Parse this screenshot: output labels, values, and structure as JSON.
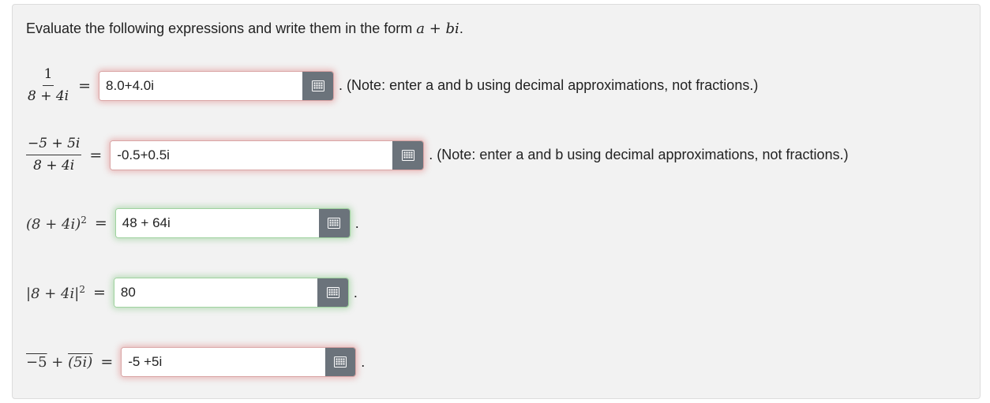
{
  "intro": {
    "text": "Evaluate the following expressions and write them in the form",
    "form": "a + bi",
    "period": "."
  },
  "problems": [
    {
      "label_num": "1",
      "label_den": "8 + 4i",
      "equals": "=",
      "answer": "8.0+4.0i",
      "status": "incorrect",
      "note": ". (Note: enter a and b using decimal approximations, not fractions.)"
    },
    {
      "label_num": "−5 + 5i",
      "label_den": "8 + 4i",
      "equals": "=",
      "answer": "-0.5+0.5i",
      "status": "incorrect",
      "note": ". (Note: enter a and b using decimal approximations, not fractions.)"
    },
    {
      "label": "(8 + 4i)",
      "label_sup": "2",
      "equals": "=",
      "answer": "48 + 64i",
      "status": "correct",
      "note": "."
    },
    {
      "label": "|8 + 4i|",
      "label_sup": "2",
      "equals": "=",
      "answer": "80",
      "status": "correct",
      "note": "."
    },
    {
      "label_part1": "−5",
      "label_plus": " + ",
      "label_part2": "(5i)",
      "equals": "=",
      "answer": "-5 +5i",
      "status": "incorrect",
      "note": "."
    }
  ],
  "icons": {
    "keyboard": "keyboard-icon"
  },
  "colors": {
    "incorrect_glow": "#d65050",
    "correct_glow": "#50b450",
    "keyboard_button": "#6b737b",
    "panel_bg": "#f2f2f2"
  }
}
